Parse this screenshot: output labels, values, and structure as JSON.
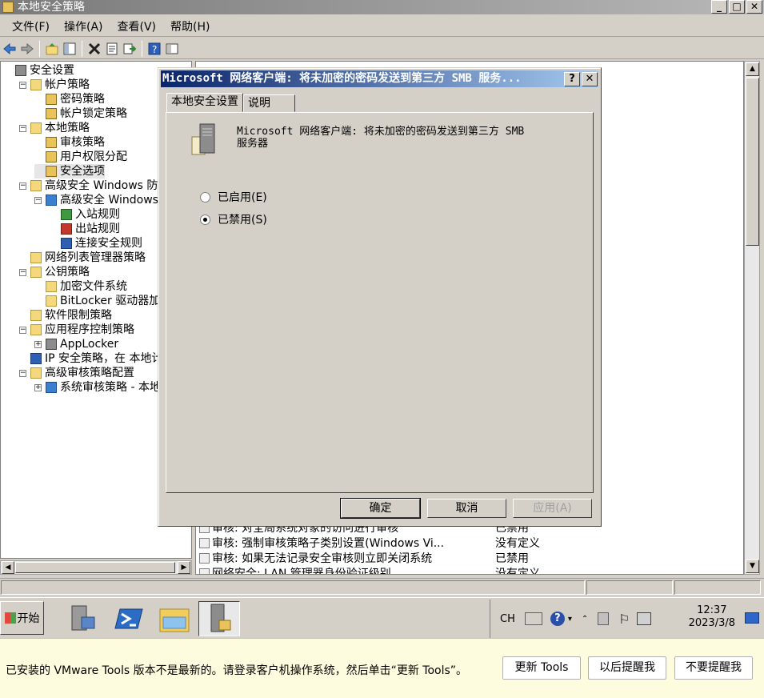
{
  "window": {
    "title": "本地安全策略",
    "min": "_",
    "max": "□",
    "close": "✕"
  },
  "menu": [
    "文件(F)",
    "操作(A)",
    "查看(V)",
    "帮助(H)"
  ],
  "tree": [
    {
      "label": "安全设置",
      "indent": 0,
      "exp": "",
      "icon": "pc"
    },
    {
      "label": "帐户策略",
      "indent": 1,
      "exp": "−",
      "icon": "folder"
    },
    {
      "label": "密码策略",
      "indent": 2,
      "exp": "",
      "icon": "lock"
    },
    {
      "label": "帐户锁定策略",
      "indent": 2,
      "exp": "",
      "icon": "lock"
    },
    {
      "label": "本地策略",
      "indent": 1,
      "exp": "−",
      "icon": "folder"
    },
    {
      "label": "审核策略",
      "indent": 2,
      "exp": "",
      "icon": "lock"
    },
    {
      "label": "用户权限分配",
      "indent": 2,
      "exp": "",
      "icon": "lock"
    },
    {
      "label": "安全选项",
      "indent": 2,
      "exp": "",
      "icon": "lock",
      "selected": true
    },
    {
      "label": "高级安全 Windows 防火墙",
      "indent": 1,
      "exp": "−",
      "icon": "folder"
    },
    {
      "label": "高级安全 Windows 防火墙 - 本地组策略对象",
      "indent": 2,
      "exp": "−",
      "icon": "fw"
    },
    {
      "label": "入站规则",
      "indent": 3,
      "exp": "",
      "icon": "rule"
    },
    {
      "label": "出站规则",
      "indent": 3,
      "exp": "",
      "icon": "rule2"
    },
    {
      "label": "连接安全规则",
      "indent": 3,
      "exp": "",
      "icon": "net"
    },
    {
      "label": "网络列表管理器策略",
      "indent": 1,
      "exp": "",
      "icon": "folder"
    },
    {
      "label": "公钥策略",
      "indent": 1,
      "exp": "−",
      "icon": "folder"
    },
    {
      "label": "加密文件系统",
      "indent": 2,
      "exp": "",
      "icon": "folder"
    },
    {
      "label": "BitLocker 驱动器加密",
      "indent": 2,
      "exp": "",
      "icon": "folder"
    },
    {
      "label": "软件限制策略",
      "indent": 1,
      "exp": "",
      "icon": "folder"
    },
    {
      "label": "应用程序控制策略",
      "indent": 1,
      "exp": "−",
      "icon": "folder"
    },
    {
      "label": "AppLocker",
      "indent": 2,
      "exp": "+",
      "icon": "pc"
    },
    {
      "label": "IP 安全策略，在 本地计算机",
      "indent": 1,
      "exp": "",
      "icon": "net"
    },
    {
      "label": "高级审核策略配置",
      "indent": 1,
      "exp": "−",
      "icon": "folder"
    },
    {
      "label": "系统审核策略 - 本地组策略对象",
      "indent": 2,
      "exp": "+",
      "icon": "fw"
    }
  ],
  "list_rows": [
    {
      "policy": "审核: 对全局系统对象的访问进行审核",
      "value": "已禁用"
    },
    {
      "policy": "审核: 强制审核策略子类别设置(Windows Vi...",
      "value": "没有定义"
    },
    {
      "policy": "审核: 如果无法记录安全审核则立即关闭系统",
      "value": "已禁用"
    },
    {
      "policy": "网络安全: LAN 管理器身份验证级别",
      "value": "没有定义"
    }
  ],
  "dialog": {
    "title": "Microsoft 网络客户端: 将未加密的密码发送到第三方 SMB 服务...",
    "help": "?",
    "close": "✕",
    "tabs": [
      "本地安全设置",
      "说明"
    ],
    "policy_line1": "Microsoft 网络客户端: 将未加密的密码发送到第三方 SMB",
    "policy_line2": "服务器",
    "options": [
      {
        "label": "已启用(E)",
        "checked": false
      },
      {
        "label": "已禁用(S)",
        "checked": true
      }
    ],
    "ok": "确定",
    "cancel": "取消",
    "apply": "应用(A)"
  },
  "taskbar": {
    "start": "开始",
    "lang": "CH",
    "time": "12:37",
    "date": "2023/3/8"
  },
  "notification": {
    "message": "已安装的 VMware Tools 版本不是最新的。请登录客户机操作系统，然后单击“更新 Tools”。",
    "update": "更新 Tools",
    "later": "以后提醒我",
    "never": "不要提醒我"
  }
}
